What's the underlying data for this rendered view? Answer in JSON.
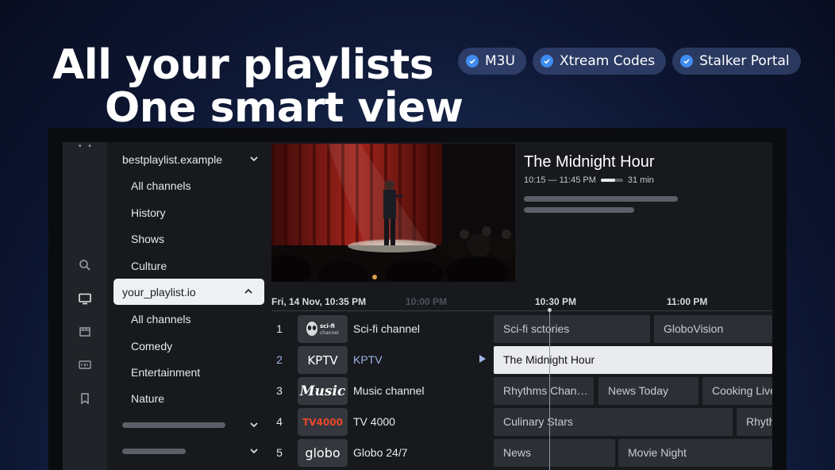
{
  "hero": {
    "line1": "All your playlists",
    "line2": "One smart view"
  },
  "badges": [
    "M3U",
    "Xtream Codes",
    "Stalker Portal"
  ],
  "sidebar": {
    "playlist1": "bestplaylist.example",
    "playlist1_items": [
      "All channels",
      "History",
      "Shows",
      "Culture"
    ],
    "playlist2": "your_playlist.io",
    "playlist2_items": [
      "All channels",
      "Comedy",
      "Entertainment",
      "Nature"
    ]
  },
  "now_playing": {
    "title": "The Midnight Hour",
    "time": "10:15 — 11:45 PM",
    "remaining": "31 min",
    "progress": 0.66
  },
  "guide": {
    "date_label": "Fri,  14 Nov, 10:35 PM",
    "faded_time": "10:00 PM",
    "times": [
      "10:30 PM",
      "11:00 PM"
    ],
    "channels": [
      {
        "num": "1",
        "logo": "sci-fi channel",
        "name": "Sci-fi channel",
        "programs": [
          "Sci-fi sctories",
          "GloboVision"
        ]
      },
      {
        "num": "2",
        "logo": "KPTV",
        "name": "KPTV",
        "programs": [
          "The Midnight Hour"
        ]
      },
      {
        "num": "3",
        "logo": "Music",
        "name": "Music channel",
        "programs": [
          "Rhythms Chan…",
          "News Today",
          "Cooking Live"
        ]
      },
      {
        "num": "4",
        "logo": "TV4000",
        "name": "TV 4000",
        "programs": [
          "Culinary Stars",
          "Rhythm"
        ]
      },
      {
        "num": "5",
        "logo": "globo",
        "name": "Globo 24/7",
        "programs": [
          "News",
          "Movie Night"
        ]
      }
    ]
  },
  "colors": {
    "accent": "#3f8cf0",
    "active_channel": "#9fb2e8"
  }
}
